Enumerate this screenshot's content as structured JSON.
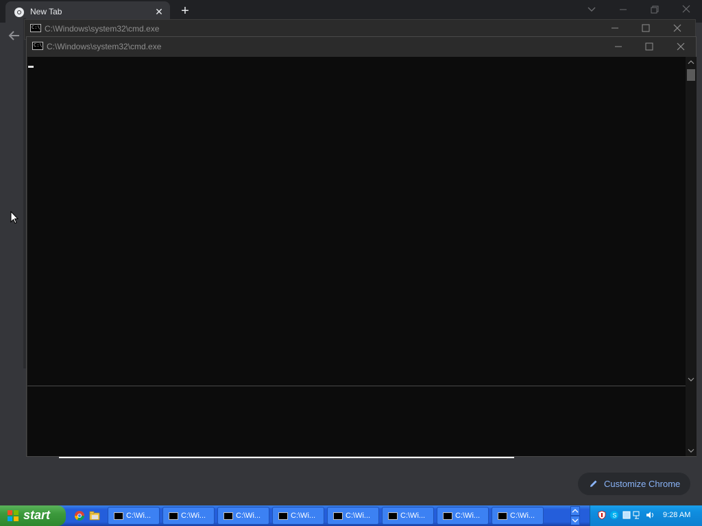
{
  "browser": {
    "tab_title": "New Tab",
    "customize_label": "Customize Chrome"
  },
  "cmd_windows": [
    {
      "title": "C:\\Windows\\system32\\cmd.exe"
    },
    {
      "title": "C:\\Windows\\system32\\cmd.exe"
    }
  ],
  "taskbar": {
    "start_label": "start",
    "tasks": [
      "C:\\Wi...",
      "C:\\Wi...",
      "C:\\Wi...",
      "C:\\Wi...",
      "C:\\Wi...",
      "C:\\Wi...",
      "C:\\Wi...",
      "C:\\Wi..."
    ],
    "clock": "9:28 AM"
  },
  "colors": {
    "chrome_bg": "#35363a",
    "console_bg": "#0c0c0c",
    "accent_link": "#8ab4f8",
    "taskbar_blue": "#245edb",
    "start_green": "#3c9a3c"
  }
}
